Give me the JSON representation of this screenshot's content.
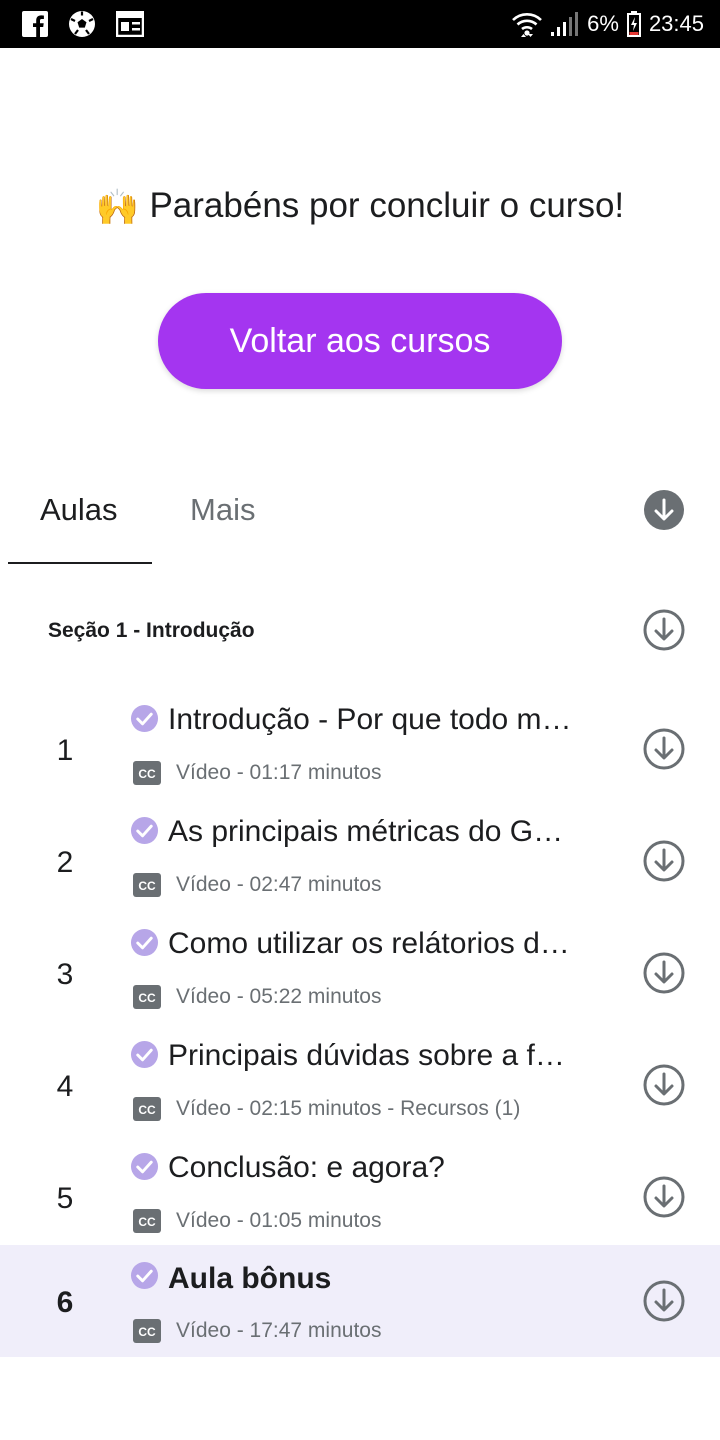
{
  "status_bar": {
    "left_icons": [
      "facebook-icon",
      "soccer-ball-icon",
      "news-icon"
    ],
    "battery_percent": "6%",
    "time": "23:45"
  },
  "congrats": {
    "emoji": "🙌",
    "message": "Parabéns por concluir o curso!",
    "back_button_label": "Voltar aos cursos"
  },
  "tabs": [
    {
      "label": "Aulas",
      "selected": true
    },
    {
      "label": "Mais",
      "selected": false
    }
  ],
  "section": {
    "title": "Seção 1 - Introdução"
  },
  "lessons": [
    {
      "number": "1",
      "title": "Introdução - Por que todo m…",
      "meta": "Vídeo - 01:17 minutos",
      "completed": true
    },
    {
      "number": "2",
      "title": "As principais métricas do G…",
      "meta": "Vídeo - 02:47 minutos",
      "completed": true
    },
    {
      "number": "3",
      "title": "Como utilizar os relátorios d…",
      "meta": "Vídeo - 05:22 minutos",
      "completed": true
    },
    {
      "number": "4",
      "title": "Principais dúvidas sobre a f…",
      "meta": "Vídeo - 02:15 minutos - Recursos (1)",
      "completed": true
    },
    {
      "number": "5",
      "title": "Conclusão: e agora?",
      "meta": "Vídeo - 01:05 minutos",
      "completed": true
    },
    {
      "number": "6",
      "title": "Aula bônus",
      "meta": "Vídeo - 17:47 minutos",
      "completed": true,
      "active": true
    }
  ],
  "colors": {
    "accent": "#a435f0",
    "check": "#b7a6e8",
    "active_row": "#f0eefa",
    "icon_gray": "#6a6f73",
    "text": "#1c1d1f"
  }
}
